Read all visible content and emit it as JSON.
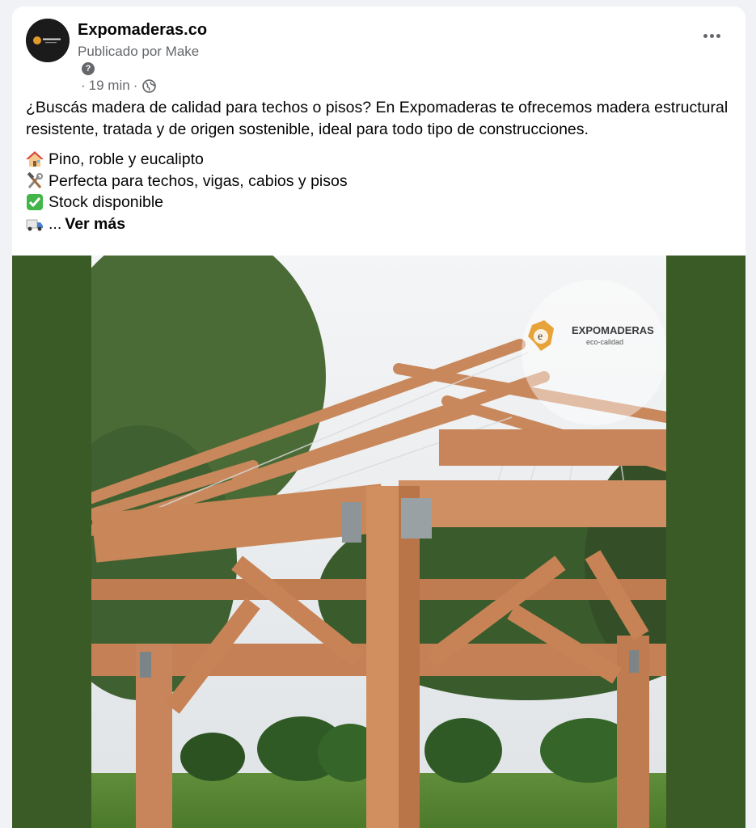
{
  "post": {
    "page_name": "Expomaderas.co",
    "posted_by": "Publicado por Make",
    "time_ago": "19 min",
    "dot": "·",
    "help_icon": "question-circle-icon",
    "privacy_icon": "globe-icon",
    "more_icon": "more-options-icon",
    "text": {
      "paragraph": "¿Buscás madera de calidad para techos o pisos? En Expomaderas te ofrecemos madera estructural resistente, tratada y de origen sostenible, ideal para todo tipo de construcciones.",
      "line1": "Pino, roble y eucalipto",
      "line2": "Perfecta para techos, vigas, cabios y pisos",
      "line3": "Stock disponible",
      "line4_ellipsis": "...",
      "see_more": "Ver más"
    },
    "emoji_icons": [
      "house-emoji-icon",
      "hammer-wrench-emoji-icon",
      "check-mark-emoji-icon",
      "truck-emoji-icon"
    ]
  },
  "image": {
    "description_icon": "wooden-gazebo-photo",
    "watermark": {
      "brand": "EXPOMADERAS",
      "tagline": "eco-calidad"
    },
    "frame_color": "#3a5a26"
  },
  "colors": {
    "background": "#f0f2f5",
    "card": "#ffffff",
    "text": "#050505",
    "secondary_text": "#65676b"
  }
}
